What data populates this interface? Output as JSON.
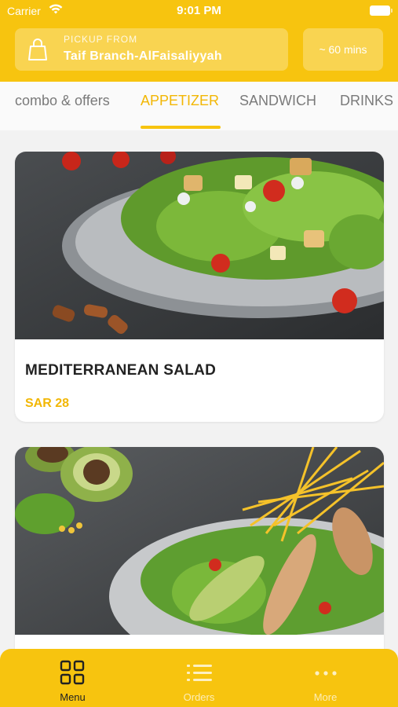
{
  "status_bar": {
    "carrier": "Carrier",
    "time": "9:01 PM"
  },
  "pickup": {
    "label": "PICKUP FROM",
    "branch": "Taif Branch-AlFaisaliyyah"
  },
  "eta": "~ 60 mins",
  "tabs": [
    {
      "label": "combo & offers",
      "active": false
    },
    {
      "label": "APPETIZER",
      "active": true
    },
    {
      "label": "SANDWICH",
      "active": false
    },
    {
      "label": "DRINKS",
      "active": false
    }
  ],
  "products": [
    {
      "name": "MEDITERRANEAN SALAD",
      "price": "SAR 28"
    },
    {
      "name": "",
      "price": ""
    }
  ],
  "bottom_nav": {
    "menu": "Menu",
    "orders": "Orders",
    "more": "More"
  },
  "colors": {
    "brand": "#f7c40f",
    "accent_text": "#f2b705",
    "background": "#f2f2f2"
  }
}
